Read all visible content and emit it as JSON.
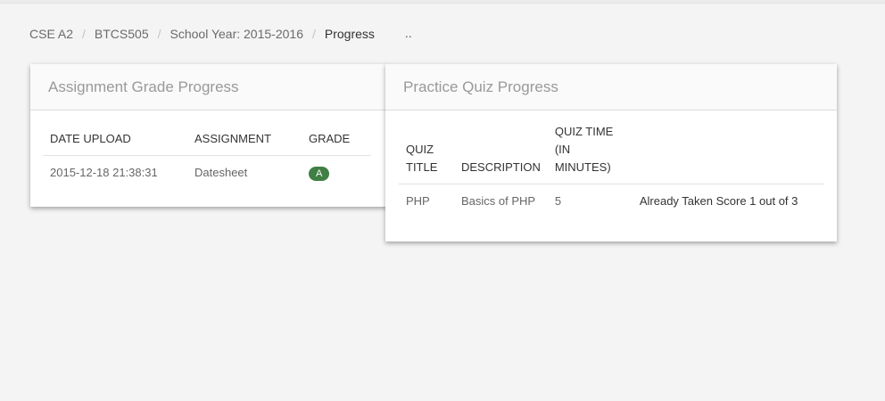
{
  "breadcrumb": {
    "items": [
      "CSE A2",
      "BTCS505",
      "School Year: 2015-2016"
    ],
    "current": "Progress",
    "extra": ".."
  },
  "assignment_panel": {
    "title": "Assignment Grade Progress",
    "columns": [
      "DATE UPLOAD",
      "ASSIGNMENT",
      "GRADE"
    ],
    "rows": [
      {
        "date": "2015-12-18 21:38:31",
        "assignment": "Datesheet",
        "grade": "A"
      }
    ]
  },
  "quiz_panel": {
    "title": "Practice Quiz Progress",
    "columns": [
      "QUIZ TITLE",
      "DESCRIPTION",
      "QUIZ TIME (IN MINUTES)",
      ""
    ],
    "rows": [
      {
        "title": "PHP",
        "description": "Basics of PHP",
        "time": "5",
        "status": "Already Taken Score 1 out of 3"
      }
    ]
  },
  "colors": {
    "grade_badge": "#3f7f44",
    "background": "#f4f4f4"
  }
}
